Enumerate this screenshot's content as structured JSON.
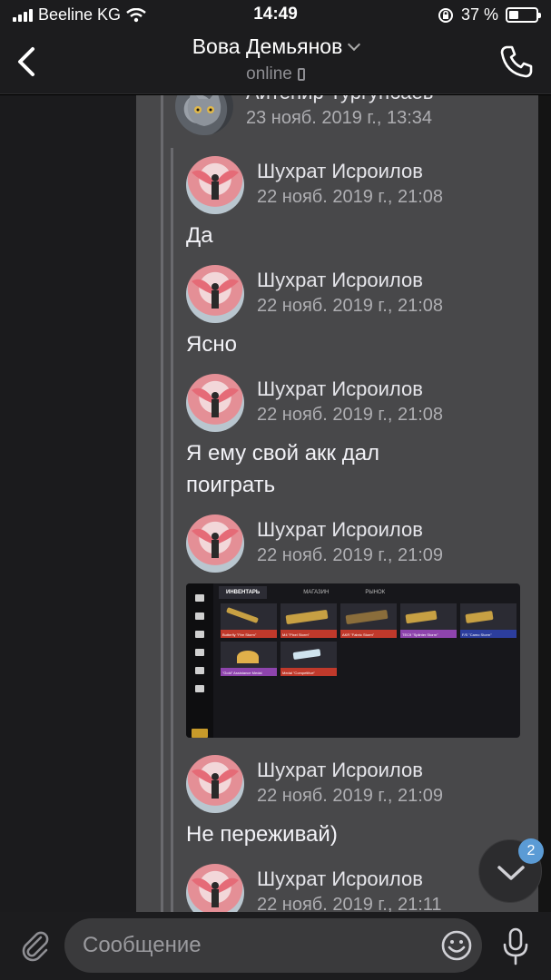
{
  "status_bar": {
    "carrier": "Beeline KG",
    "time": "14:49",
    "battery": "37 %",
    "battery_level": 0.37,
    "icons": [
      "signal-icon",
      "wifi-icon",
      "rotation-lock-icon",
      "battery-icon"
    ]
  },
  "header": {
    "title": "Вова Демьянов",
    "subtitle": "online",
    "icons": [
      "back-chevron-icon",
      "chevron-down-icon",
      "phone-device-icon",
      "call-icon"
    ]
  },
  "messages": [
    {
      "author": "Айтенир Тургунбаев",
      "date": "23 нояб. 2019 г., 13:34",
      "text": ""
    },
    {
      "author": "Шухрат Исроилов",
      "date": "22 нояб. 2019 г., 21:08",
      "text": "Да"
    },
    {
      "author": "Шухрат Исроилов",
      "date": "22 нояб. 2019 г., 21:08",
      "text": "Ясно"
    },
    {
      "author": "Шухрат Исроилов",
      "date": "22 нояб. 2019 г., 21:08",
      "text": "Я ему свой акк дал поиграть"
    },
    {
      "author": "Шухрат Исроилов",
      "date": "22 нояб. 2019 г., 21:09",
      "text": ""
    },
    {
      "author": "Шухрат Исроилов",
      "date": "22 нояб. 2019 г., 21:09",
      "text": "Не переживай)"
    },
    {
      "author": "Шухрат Исроилов",
      "date": "22 нояб. 2019 г., 21:11",
      "text": ""
    }
  ],
  "attachment": {
    "tabs": [
      "ИНВЕНТАРЬ",
      "МАГАЗИН",
      "РЫНОК"
    ],
    "items": [
      {
        "label": "Butterfly \"Fire Storm\"",
        "color": "#c0392b"
      },
      {
        "label": "M4 \"Pixel Storm\"",
        "color": "#c0392b"
      },
      {
        "label": "AKR \"Fabric Storm\"",
        "color": "#c0392b"
      },
      {
        "label": "TEC9 \"Splinter Storm\"",
        "color": "#8e44ad"
      },
      {
        "label": "F/S \"Camo Storm\"",
        "color": "#2c3e9e"
      },
      {
        "label": "\"Gold\" Assistance Medal",
        "color": "#8e44ad"
      },
      {
        "label": "Medal \"Competitive\"",
        "color": "#c0392b"
      }
    ]
  },
  "scroll_badge": "2",
  "composer": {
    "placeholder": "Сообщение",
    "icons": [
      "paperclip-icon",
      "emoji-icon",
      "microphone-icon"
    ]
  }
}
